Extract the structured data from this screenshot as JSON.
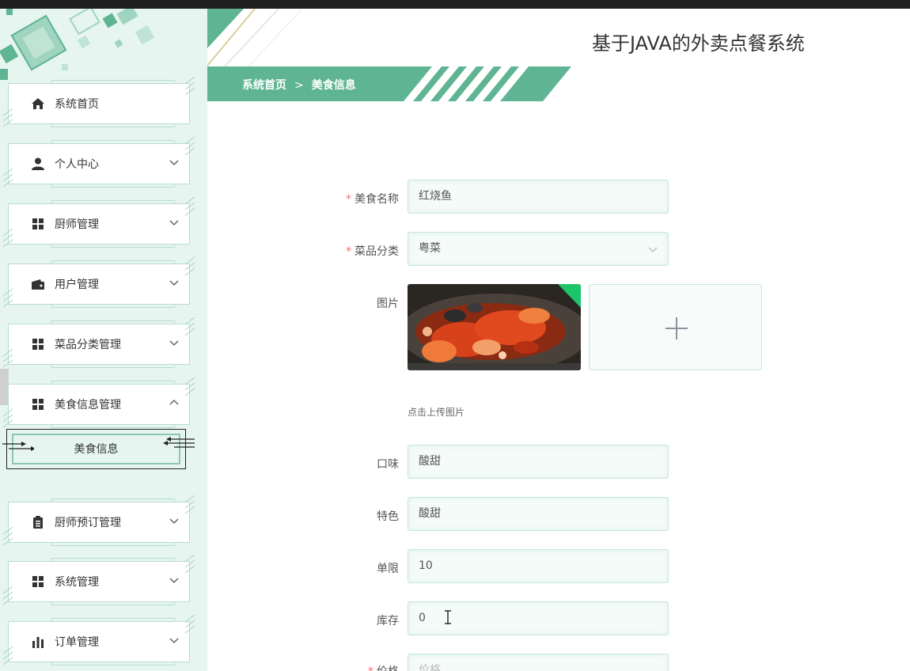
{
  "app": {
    "title": "基于JAVA的外卖点餐系统"
  },
  "breadcrumb": {
    "home": "系统首页",
    "separator": ">",
    "current": "美食信息"
  },
  "sidebar": {
    "items": [
      {
        "label": "系统首页",
        "icon": "home-icon",
        "chevron": "none"
      },
      {
        "label": "个人中心",
        "icon": "user-icon",
        "chevron": "down"
      },
      {
        "label": "厨师管理",
        "icon": "grid-icon",
        "chevron": "down"
      },
      {
        "label": "用户管理",
        "icon": "wallet-icon",
        "chevron": "down"
      },
      {
        "label": "菜品分类管理",
        "icon": "grid-icon",
        "chevron": "down"
      },
      {
        "label": "美食信息管理",
        "icon": "grid-icon",
        "chevron": "up"
      },
      {
        "label": "厨师预订管理",
        "icon": "clipboard-icon",
        "chevron": "down"
      },
      {
        "label": "系统管理",
        "icon": "grid-icon",
        "chevron": "down"
      },
      {
        "label": "订单管理",
        "icon": "bar-chart-icon",
        "chevron": "down"
      }
    ],
    "sub_item": {
      "label": "美食信息"
    }
  },
  "form": {
    "name": {
      "label": "美食名称",
      "required": true,
      "value": "红烧鱼"
    },
    "category": {
      "label": "菜品分类",
      "required": true,
      "value": "粤菜"
    },
    "image": {
      "label": "图片",
      "hint": "点击上传图片"
    },
    "taste": {
      "label": "口味",
      "value": "酸甜"
    },
    "feature": {
      "label": "特色",
      "value": "酸甜"
    },
    "limit": {
      "label": "单限",
      "value": "10"
    },
    "stock": {
      "label": "库存",
      "value": "0"
    },
    "price": {
      "label": "价格",
      "required": true,
      "placeholder": "价格"
    }
  },
  "colors": {
    "accent": "#5fb493",
    "sidebar_bg": "#e6f5ef",
    "required": "#f56c6c"
  }
}
